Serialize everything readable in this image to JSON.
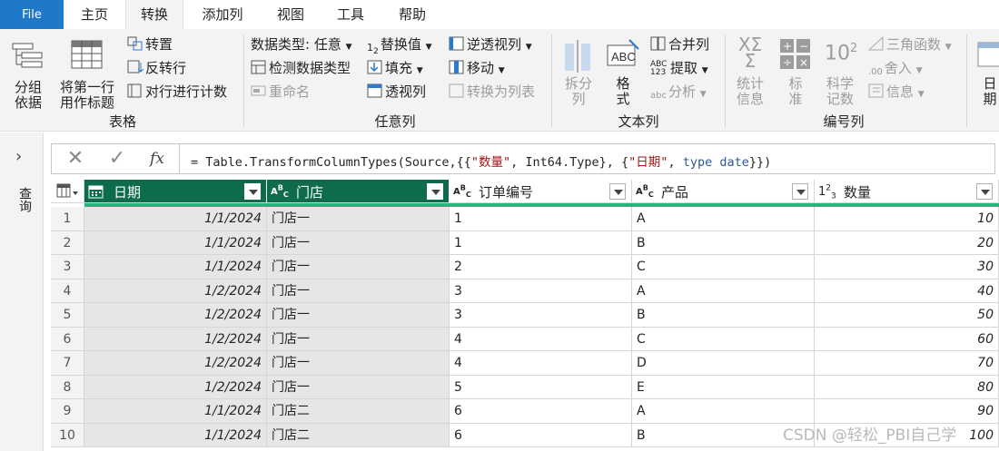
{
  "tabs": {
    "file": "File",
    "home": "主页",
    "transform": "转换",
    "add_column": "添加列",
    "view": "视图",
    "tools": "工具",
    "help": "帮助"
  },
  "ribbon": {
    "table_group": {
      "group_by": "分组\n依据",
      "use_first_row": "将第一行\n用作标题",
      "transpose": "转置",
      "reverse_rows": "反转行",
      "count_rows": "对行进行计数",
      "label": "表格"
    },
    "any_column_group": {
      "data_type": "数据类型: 任意",
      "detect_type": "检测数据类型",
      "rename": "重命名",
      "replace_values": "替换值",
      "fill": "填充",
      "pivot": "透视列",
      "unpivot": "逆透视列",
      "move": "移动",
      "convert_to_list": "转换为列表",
      "label": "任意列"
    },
    "text_column_group": {
      "split_column": "拆分\n列",
      "format": "格\n式",
      "merge_columns": "合并列",
      "extract": "提取",
      "parse": "分析",
      "label": "文本列"
    },
    "number_column_group": {
      "statistics": "统计\n信息",
      "standard": "标\n准",
      "scientific": "科学\n记数",
      "trig": "三角函数",
      "rounding": "舍入",
      "information": "信息",
      "label": "编号列"
    },
    "date_partial": "日\n期"
  },
  "nav": {
    "queries_label": "查询"
  },
  "formula_bar": {
    "cancel": "✕",
    "confirm": "✓",
    "fx": "fx",
    "formula": "= Table.TransformColumnTypes(Source,{{\"数量\", Int64.Type}, {\"日期\", type date}})"
  },
  "table": {
    "columns": [
      {
        "type_icon": "date",
        "name": "日期",
        "selected": true
      },
      {
        "type_icon": "ABC",
        "name": "门店",
        "selected": true
      },
      {
        "type_icon": "ABC",
        "name": "订单编号",
        "selected": false
      },
      {
        "type_icon": "ABC",
        "name": "产品",
        "selected": false
      },
      {
        "type_icon": "123",
        "name": "数量",
        "selected": false
      }
    ],
    "rows": [
      {
        "n": "1",
        "date": "1/1/2024",
        "store": "门店一",
        "order": "1",
        "product": "A",
        "qty": "10"
      },
      {
        "n": "2",
        "date": "1/1/2024",
        "store": "门店一",
        "order": "1",
        "product": "B",
        "qty": "20"
      },
      {
        "n": "3",
        "date": "1/1/2024",
        "store": "门店一",
        "order": "2",
        "product": "C",
        "qty": "30"
      },
      {
        "n": "4",
        "date": "1/2/2024",
        "store": "门店一",
        "order": "3",
        "product": "A",
        "qty": "40"
      },
      {
        "n": "5",
        "date": "1/2/2024",
        "store": "门店一",
        "order": "3",
        "product": "B",
        "qty": "50"
      },
      {
        "n": "6",
        "date": "1/2/2024",
        "store": "门店一",
        "order": "4",
        "product": "C",
        "qty": "60"
      },
      {
        "n": "7",
        "date": "1/2/2024",
        "store": "门店一",
        "order": "4",
        "product": "D",
        "qty": "70"
      },
      {
        "n": "8",
        "date": "1/2/2024",
        "store": "门店一",
        "order": "5",
        "product": "E",
        "qty": "80"
      },
      {
        "n": "9",
        "date": "1/1/2024",
        "store": "门店二",
        "order": "6",
        "product": "A",
        "qty": "90"
      },
      {
        "n": "10",
        "date": "1/1/2024",
        "store": "门店二",
        "order": "6",
        "product": "B",
        "qty": "100"
      }
    ]
  },
  "watermark": "CSDN @轻松_PBI自己学",
  "colors": {
    "file_tab": "#1f78c8",
    "selected_header": "#0f6b4e",
    "quality_bar": "#24b47e",
    "ribbon_bg": "#f3f3f3"
  }
}
